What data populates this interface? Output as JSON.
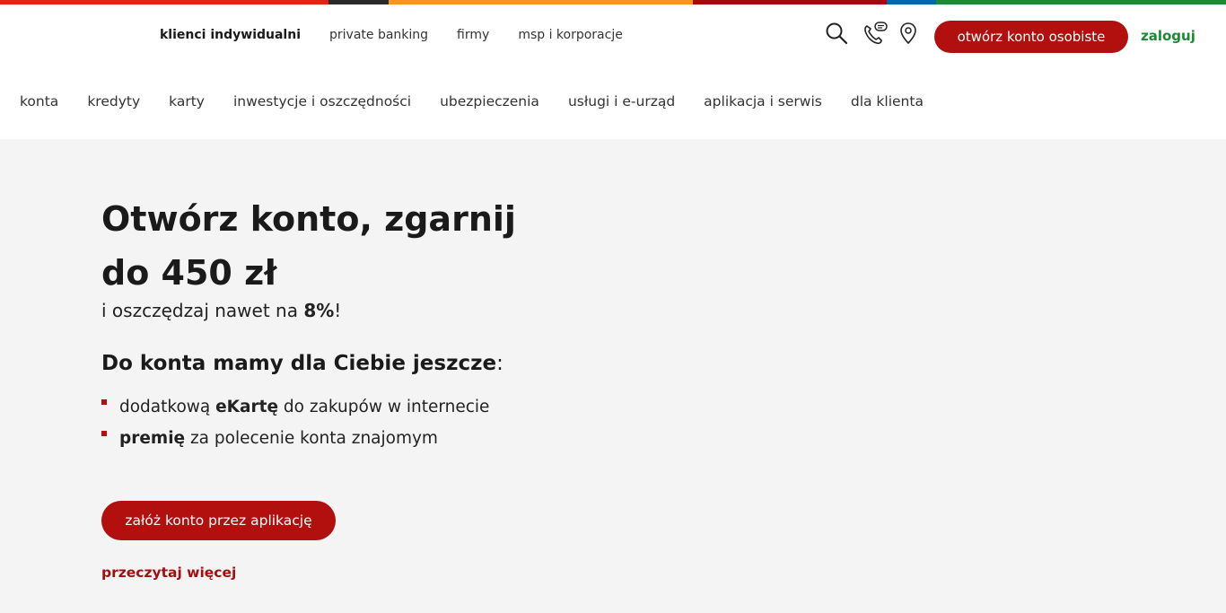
{
  "brand_colors": {
    "accent_red": "#b20f0f",
    "login_green": "#1d8a33",
    "hero_background": "#f4f4f4"
  },
  "top_stripe": [
    "#e2231a",
    "#2a2a2a",
    "#f7941d",
    "#a6090f",
    "#0067b1",
    "#1d8a33"
  ],
  "top_nav": {
    "items": [
      {
        "label": "klienci indywidualni",
        "active": true
      },
      {
        "label": "private banking",
        "active": false
      },
      {
        "label": "firmy",
        "active": false
      },
      {
        "label": "msp i korporacje",
        "active": false
      }
    ]
  },
  "utilities": {
    "language_flag": "ukraine-flag-icon",
    "icons": [
      "search-icon",
      "phone-chat-icon",
      "location-pin-icon"
    ]
  },
  "header": {
    "open_account_label": "otwórz konto osobiste",
    "login_label": "zaloguj"
  },
  "main_nav": {
    "items": [
      "konta",
      "kredyty",
      "karty",
      "inwestycje i oszczędności",
      "ubezpieczenia",
      "usługi i e-urząd",
      "aplikacja i serwis",
      "dla klienta"
    ]
  },
  "hero": {
    "title_line1": "Otwórz konto, zgarnij",
    "title_line2": "do 450 zł",
    "subtitle_prefix": "i oszczędzaj nawet na ",
    "subtitle_bold": "8%",
    "subtitle_suffix": "!",
    "extras_heading": "Do konta mamy dla Ciebie jeszcze",
    "extras_heading_colon": ":",
    "extras": [
      {
        "before": "dodatkową ",
        "bold": "eKartę",
        "after": " do zakupów w internecie"
      },
      {
        "before": "",
        "bold": "premię",
        "after": " za polecenie konta znajomym"
      }
    ],
    "cta_label": "załóż konto przez aplikację",
    "read_more_label": "przeczytaj więcej"
  }
}
